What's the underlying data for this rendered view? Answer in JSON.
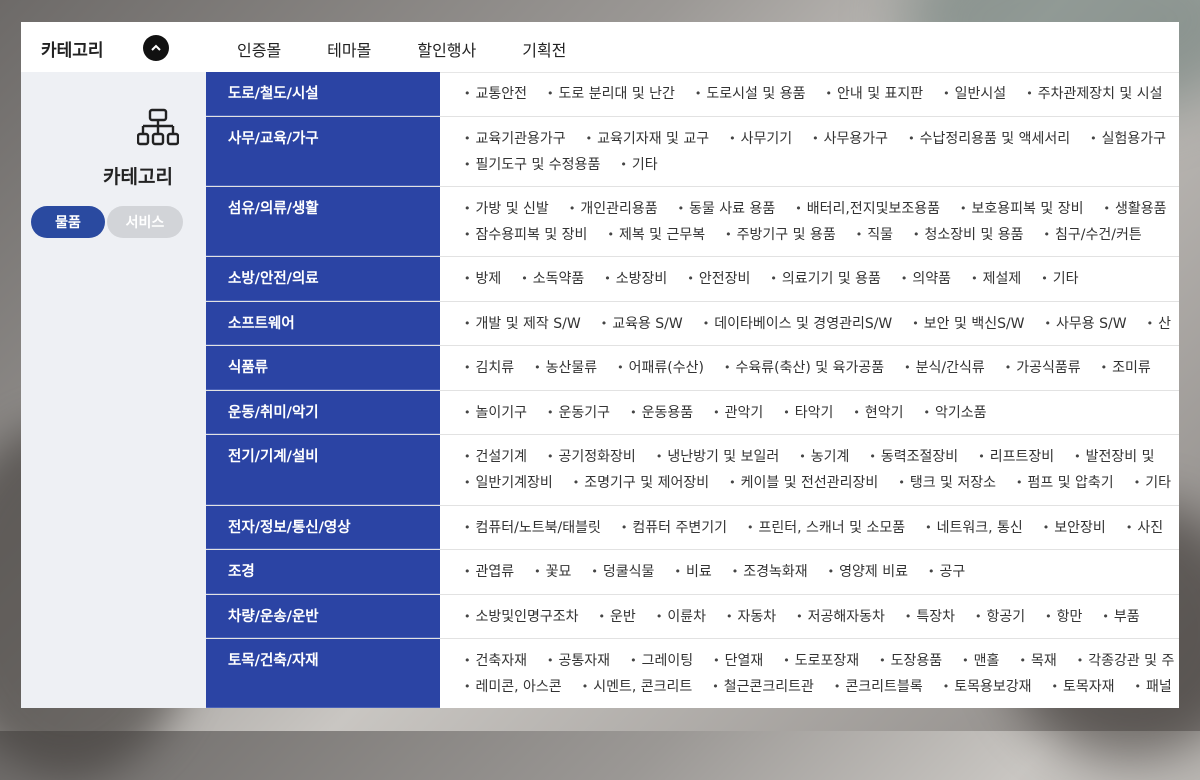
{
  "header": {
    "title": "카테고리",
    "nav": [
      "인증몰",
      "테마몰",
      "할인행사",
      "기획전"
    ]
  },
  "sidebar": {
    "title": "카테고리",
    "toggle": {
      "goods": "물품",
      "service": "서비스",
      "active": "goods"
    }
  },
  "colors": {
    "accent": "#2b44a4",
    "toggle_active": "#2a4aa0",
    "toggle_inactive": "#d2d4d8"
  },
  "categories": [
    {
      "name": "도로/철도/시설",
      "lines": [
        [
          "교통안전",
          "도로 분리대 및 난간",
          "도로시설 및 용품",
          "안내 및 표지판",
          "일반시설",
          "주차관제장치 및 시설"
        ]
      ]
    },
    {
      "name": "사무/교육/가구",
      "lines": [
        [
          "교육기관용가구",
          "교육기자재 및 교구",
          "사무기기",
          "사무용가구",
          "수납정리용품 및 액세서리",
          "실험용가구"
        ],
        [
          "필기도구 및 수정용품",
          "기타"
        ]
      ]
    },
    {
      "name": "섬유/의류/생활",
      "lines": [
        [
          "가방 및 신발",
          "개인관리용품",
          "동물 사료 용품",
          "배터리,전지및보조용품",
          "보호용피복 및 장비",
          "생활용품"
        ],
        [
          "잠수용피복 및 장비",
          "제복 및 근무복",
          "주방기구 및 용품",
          "직물",
          "청소장비 및 용품",
          "침구/수건/커튼"
        ]
      ]
    },
    {
      "name": "소방/안전/의료",
      "lines": [
        [
          "방제",
          "소독약품",
          "소방장비",
          "안전장비",
          "의료기기 및 용품",
          "의약품",
          "제설제",
          "기타"
        ]
      ]
    },
    {
      "name": "소프트웨어",
      "lines": [
        [
          "개발 및 제작 S/W",
          "교육용 S/W",
          "데이타베이스 및 경영관리S/W",
          "보안 및 백신S/W",
          "사무용 S/W",
          "산"
        ]
      ]
    },
    {
      "name": "식품류",
      "lines": [
        [
          "김치류",
          "농산물류",
          "어패류(수산)",
          "수육류(축산) 및 육가공품",
          "분식/간식류",
          "가공식품류",
          "조미류"
        ]
      ]
    },
    {
      "name": "운동/취미/악기",
      "lines": [
        [
          "놀이기구",
          "운동기구",
          "운동용품",
          "관악기",
          "타악기",
          "현악기",
          "악기소품"
        ]
      ]
    },
    {
      "name": "전기/기계/설비",
      "lines": [
        [
          "건설기계",
          "공기정화장비",
          "냉난방기 및 보일러",
          "농기계",
          "동력조절장비",
          "리프트장비",
          "발전장비 및"
        ],
        [
          "일반기계장비",
          "조명기구 및 제어장비",
          "케이블 및 전선관리장비",
          "탱크 및 저장소",
          "펌프 및 압축기",
          "기타"
        ]
      ]
    },
    {
      "name": "전자/정보/통신/영상",
      "lines": [
        [
          "컴퓨터/노트북/태블릿",
          "컴퓨터 주변기기",
          "프린터, 스캐너 및 소모품",
          "네트워크, 통신",
          "보안장비",
          "사진"
        ]
      ]
    },
    {
      "name": "조경",
      "lines": [
        [
          "관엽류",
          "꽃묘",
          "덩쿨식물",
          "비료",
          "조경녹화재",
          "영양제 비료",
          "공구"
        ]
      ]
    },
    {
      "name": "차량/운송/운반",
      "lines": [
        [
          "소방및인명구조차",
          "운반",
          "이륜차",
          "자동차",
          "저공해자동차",
          "특장차",
          "항공기",
          "항만",
          "부품"
        ]
      ]
    },
    {
      "name": "토목/건축/자재",
      "lines": [
        [
          "건축자재",
          "공통자재",
          "그레이팅",
          "단열재",
          "도로포장재",
          "도장용품",
          "맨홀",
          "목재",
          "각종강관 및 주"
        ],
        [
          "레미콘, 아스콘",
          "시멘트, 콘크리트",
          "철근콘크리트관",
          "콘크리트블록",
          "토목용보강재",
          "토목자재",
          "패널"
        ]
      ]
    }
  ]
}
